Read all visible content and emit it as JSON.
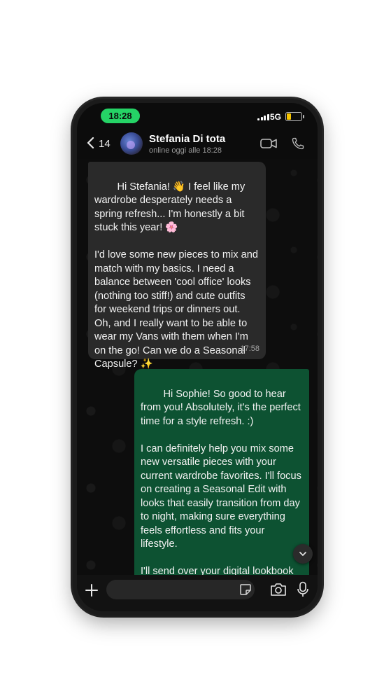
{
  "status_bar": {
    "time": "18:28",
    "network": "5G"
  },
  "header": {
    "back_count": "14",
    "contact_name": "Stefania Di tota",
    "contact_status": "online oggi alle 18:28"
  },
  "messages": [
    {
      "direction": "incoming",
      "text": "Hi Stefania! 👋 I feel like my wardrobe desperately needs a spring refresh... I'm honestly a bit stuck this year! 🌸\n\nI'd love some new pieces to mix and match with my basics. I need a balance between 'cool office' looks (nothing too stiff!) and cute outfits for weekend trips or dinners out. Oh, and I really want to be able to wear my Vans with them when I'm on the go! Can we do a Seasonal Capsule? ✨",
      "time": "17:58"
    },
    {
      "direction": "outgoing",
      "text": "Hi Sophie! So good to hear from you! Absolutely, it's the perfect time for a style refresh. :)\n\nI can definitely help you mix some new versatile pieces with your current wardrobe favorites. I'll focus on creating a Seasonal Edit with looks that easily transition from day to night, making sure everything feels effortless and fits your lifestyle.\n\nI'll send over your digital lookbook with all the shoppable links in a"
    }
  ],
  "input": {
    "placeholder": ""
  },
  "colors": {
    "time_pill": "#25d366",
    "outgoing_bubble": "#0d5232",
    "incoming_bubble": "#2a2a2a",
    "battery": "#f7c500"
  },
  "icons": [
    "chevron-left-icon",
    "video-camera-icon",
    "phone-icon",
    "chevron-down-icon",
    "plus-icon",
    "sticker-icon",
    "camera-icon",
    "microphone-icon"
  ]
}
